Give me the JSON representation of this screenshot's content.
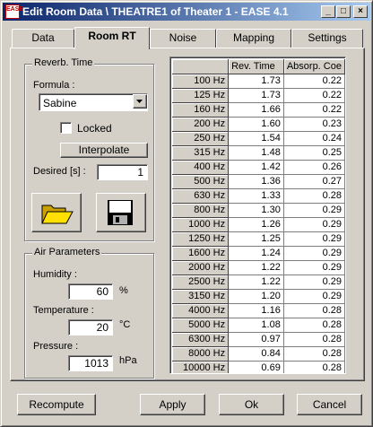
{
  "window": {
    "title": "Edit Room Data \\ THEATRE1 of Theater 1 - EASE 4.1",
    "icon_text": "EASE",
    "controls": [
      "_",
      "□",
      "×"
    ]
  },
  "tabs": [
    {
      "label": "Data",
      "active": false
    },
    {
      "label": "Room RT",
      "active": true
    },
    {
      "label": "Noise",
      "active": false
    },
    {
      "label": "Mapping",
      "active": false
    },
    {
      "label": "Settings",
      "active": false
    }
  ],
  "reverb": {
    "group_title": "Reverb. Time",
    "formula_label": "Formula :",
    "formula_value": "Sabine",
    "locked_label": "Locked",
    "locked_checked": false,
    "interpolate_label": "Interpolate",
    "desired_label": "Desired [s] :",
    "desired_value": "1"
  },
  "air": {
    "group_title": "Air Parameters",
    "humidity_label": "Humidity :",
    "humidity_value": "60",
    "humidity_unit": "%",
    "temperature_label": "Temperature :",
    "temperature_value": "20",
    "temperature_unit": "°C",
    "pressure_label": "Pressure :",
    "pressure_value": "1013",
    "pressure_unit": "hPa"
  },
  "table": {
    "columns": [
      "",
      "Rev. Time",
      "Absorp. Coe"
    ],
    "rows": [
      {
        "freq": "100 Hz",
        "rt": "1.73",
        "abs": "0.22"
      },
      {
        "freq": "125 Hz",
        "rt": "1.73",
        "abs": "0.22"
      },
      {
        "freq": "160 Hz",
        "rt": "1.66",
        "abs": "0.22"
      },
      {
        "freq": "200 Hz",
        "rt": "1.60",
        "abs": "0.23"
      },
      {
        "freq": "250 Hz",
        "rt": "1.54",
        "abs": "0.24"
      },
      {
        "freq": "315 Hz",
        "rt": "1.48",
        "abs": "0.25"
      },
      {
        "freq": "400 Hz",
        "rt": "1.42",
        "abs": "0.26"
      },
      {
        "freq": "500 Hz",
        "rt": "1.36",
        "abs": "0.27"
      },
      {
        "freq": "630 Hz",
        "rt": "1.33",
        "abs": "0.28"
      },
      {
        "freq": "800 Hz",
        "rt": "1.30",
        "abs": "0.29"
      },
      {
        "freq": "1000 Hz",
        "rt": "1.26",
        "abs": "0.29"
      },
      {
        "freq": "1250 Hz",
        "rt": "1.25",
        "abs": "0.29"
      },
      {
        "freq": "1600 Hz",
        "rt": "1.24",
        "abs": "0.29"
      },
      {
        "freq": "2000 Hz",
        "rt": "1.22",
        "abs": "0.29"
      },
      {
        "freq": "2500 Hz",
        "rt": "1.22",
        "abs": "0.29"
      },
      {
        "freq": "3150 Hz",
        "rt": "1.20",
        "abs": "0.29"
      },
      {
        "freq": "4000 Hz",
        "rt": "1.16",
        "abs": "0.28"
      },
      {
        "freq": "5000 Hz",
        "rt": "1.08",
        "abs": "0.28"
      },
      {
        "freq": "6300 Hz",
        "rt": "0.97",
        "abs": "0.28"
      },
      {
        "freq": "8000 Hz",
        "rt": "0.84",
        "abs": "0.28"
      },
      {
        "freq": "10000 Hz",
        "rt": "0.69",
        "abs": "0.28"
      }
    ]
  },
  "buttons": {
    "recompute": "Recompute",
    "apply": "Apply",
    "ok": "Ok",
    "cancel": "Cancel"
  },
  "icons": {
    "open": "folder-open-icon",
    "save": "floppy-disk-icon"
  }
}
